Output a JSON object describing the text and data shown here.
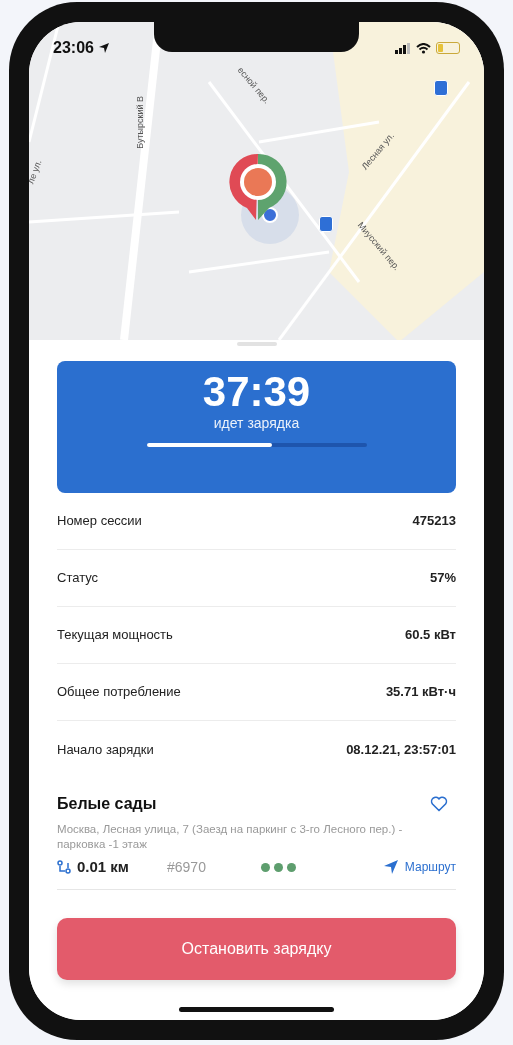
{
  "status_bar": {
    "time": "23:06"
  },
  "map": {
    "labels": [
      {
        "text": "Бутырский В",
        "kind": "street"
      },
      {
        "text": "есной пер.",
        "kind": "street"
      },
      {
        "text": "Лесная ул.",
        "kind": "street"
      },
      {
        "text": "Миусский пер.",
        "kind": "street"
      },
      {
        "text": "ле ул.",
        "kind": "street"
      }
    ]
  },
  "session": {
    "timer": "37:39",
    "caption": "идет зарядка",
    "level": 0.57
  },
  "rows": [
    {
      "label": "Номер сессии",
      "value": "475213"
    },
    {
      "label": "Статус",
      "value": "57%"
    },
    {
      "label": "Текущая мощность",
      "value": "60.5 кВт"
    },
    {
      "label": "Общее потребление",
      "value": "35.71 кВт·ч"
    },
    {
      "label": "Начало зарядки",
      "value": "08.12.21, 23:57:01"
    }
  ],
  "station": {
    "name": "Белые сады",
    "favorite": false,
    "address": "Москва, Лесная улица, 7 (Заезд на паркинг с 3-го Лесного пер.) - парковка -1 этаж",
    "distance": "0.01 км",
    "number": "#6970",
    "connectors": [
      {
        "color": "#5e9e6e"
      },
      {
        "color": "#5e9e6e"
      },
      {
        "color": "#5e9e6e"
      }
    ],
    "route": "Маршрут"
  },
  "stop_button": "Остановить зарядку"
}
